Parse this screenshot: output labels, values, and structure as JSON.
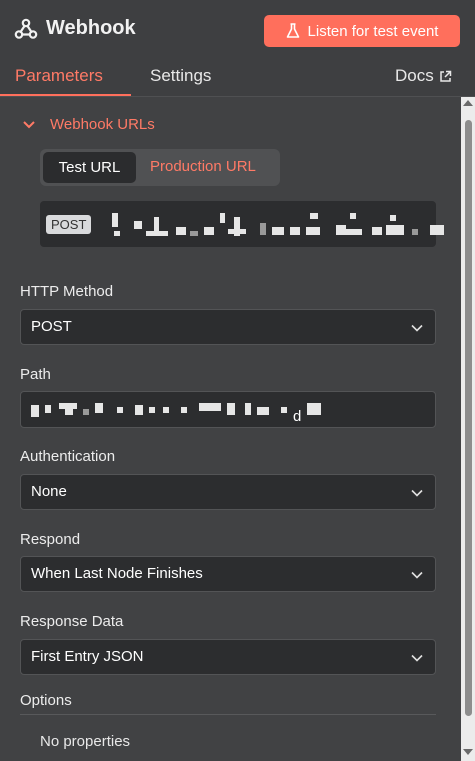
{
  "header": {
    "title": "Webhook",
    "listen_button": "Listen for test event",
    "icons": {
      "logo": "webhook-icon",
      "flask": "flask-icon",
      "external": "external-link-icon"
    }
  },
  "tabs": {
    "parameters": "Parameters",
    "settings": "Settings",
    "docs": "Docs"
  },
  "webhook_urls": {
    "title": "Webhook URLs",
    "test_tab": "Test URL",
    "production_tab": "Production URL",
    "method": "POST"
  },
  "fields": {
    "http_method": {
      "label": "HTTP Method",
      "value": "POST"
    },
    "path": {
      "label": "Path",
      "visible_char": "d"
    },
    "authentication": {
      "label": "Authentication",
      "value": "None"
    },
    "respond": {
      "label": "Respond",
      "value": "When Last Node Finishes"
    },
    "response_data": {
      "label": "Response Data",
      "value": "First Entry JSON"
    }
  },
  "options": {
    "label": "Options",
    "empty_text": "No properties"
  },
  "colors": {
    "accent": "#ff6f5c",
    "background": "#414244",
    "input_bg": "#2c2d2f"
  }
}
